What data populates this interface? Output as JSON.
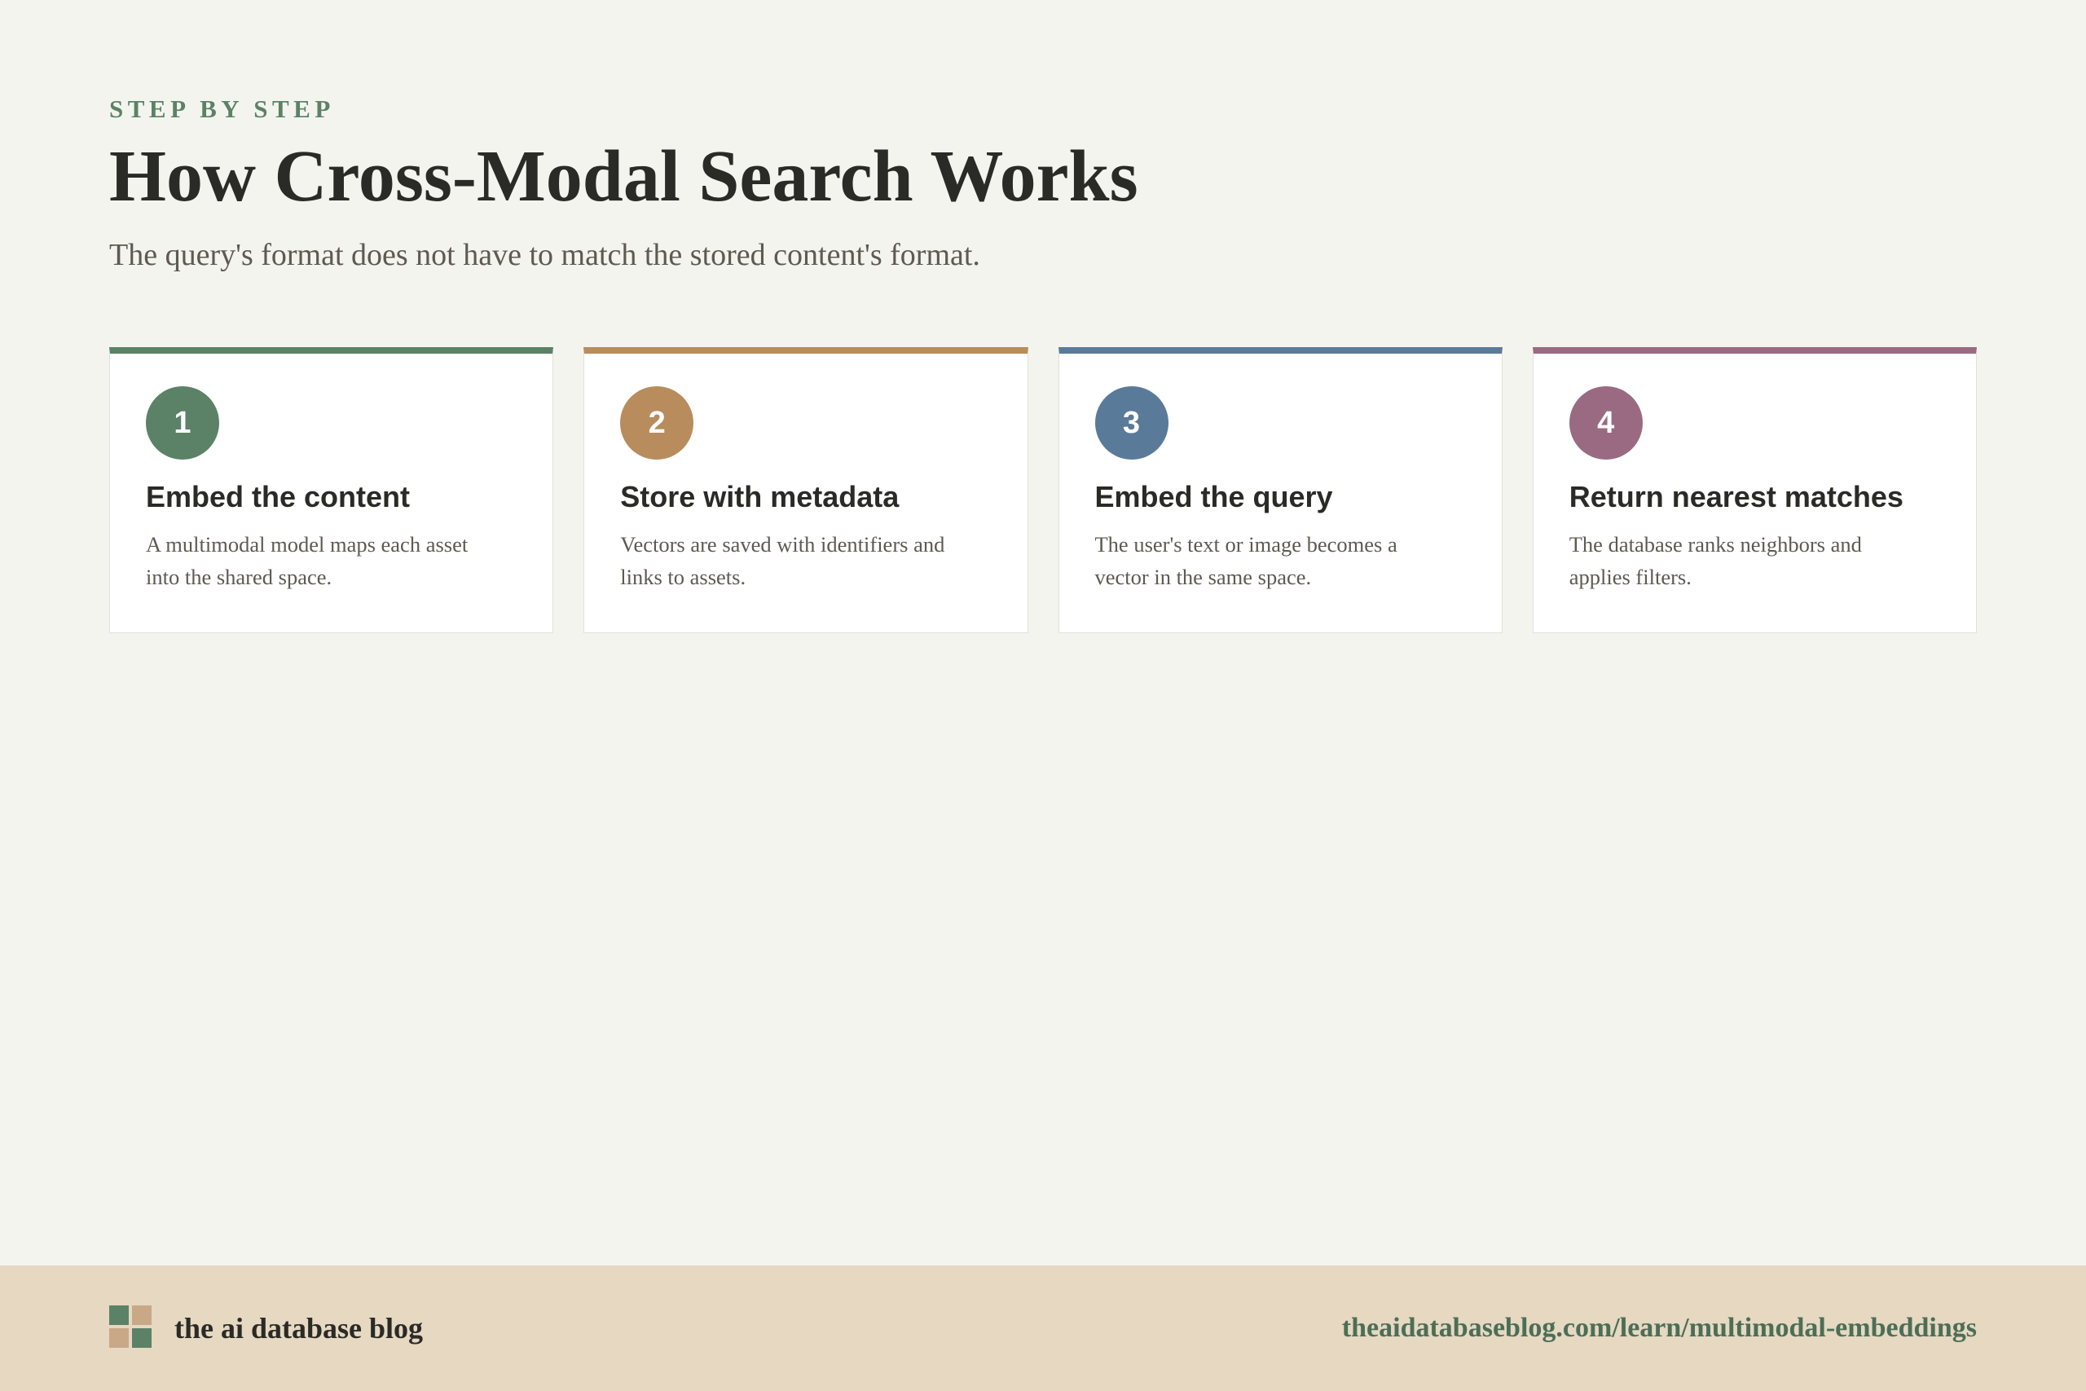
{
  "header": {
    "eyebrow": "STEP BY STEP",
    "title": "How Cross-Modal Search Works",
    "subtitle": "The query's format does not have to match the stored content's format."
  },
  "steps": [
    {
      "number": "1",
      "title": "Embed the content",
      "description": "A multimodal model maps each asset into the shared space.",
      "color": "#5b8266"
    },
    {
      "number": "2",
      "title": "Store with metadata",
      "description": "Vectors are saved with identifiers and links to assets.",
      "color": "#b88c5c"
    },
    {
      "number": "3",
      "title": "Embed the query",
      "description": "The user's text or image becomes a vector in the same space.",
      "color": "#5a7a99"
    },
    {
      "number": "4",
      "title": "Return nearest matches",
      "description": "The database ranks neighbors and applies filters.",
      "color": "#9a6a82"
    }
  ],
  "footer": {
    "brand": "the ai database blog",
    "url": "theaidatabaseblog.com/learn/multimodal-embeddings",
    "logo_colors": [
      "#5b8266",
      "#c9a888",
      "#c9a888",
      "#5b8266"
    ]
  }
}
